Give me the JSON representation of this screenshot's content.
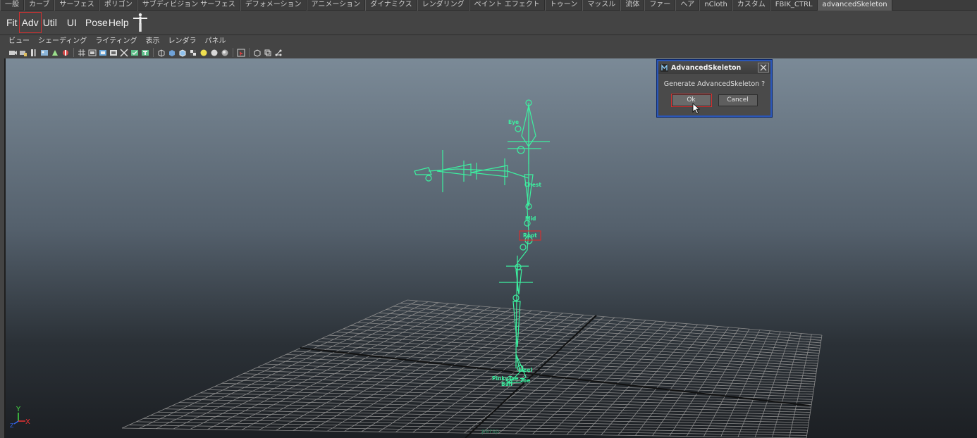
{
  "shelf_tabs": [
    {
      "label": "一般"
    },
    {
      "label": "カーブ"
    },
    {
      "label": "サーフェス"
    },
    {
      "label": "ポリゴン"
    },
    {
      "label": "サブディビジョン サーフェス"
    },
    {
      "label": "デフォメーション"
    },
    {
      "label": "アニメーション"
    },
    {
      "label": "ダイナミクス"
    },
    {
      "label": "レンダリング"
    },
    {
      "label": "ペイント エフェクト"
    },
    {
      "label": "トゥーン"
    },
    {
      "label": "マッスル"
    },
    {
      "label": "流体"
    },
    {
      "label": "ファー"
    },
    {
      "label": "ヘア"
    },
    {
      "label": "nCloth"
    },
    {
      "label": "カスタム"
    },
    {
      "label": "FBIK_CTRL"
    },
    {
      "label": "advancedSkeleton",
      "active": true
    }
  ],
  "shelf_buttons": {
    "fit": "Fit",
    "adv": "Adv",
    "util": "Util",
    "ui": "UI",
    "pose": "Pose",
    "help": "Help"
  },
  "panel_menu": {
    "view": "ビュー",
    "shading": "シェーディング",
    "lighting": "ライティング",
    "show": "表示",
    "renderer": "レンダラ",
    "panels": "パネル"
  },
  "viewport": {
    "camera_label": "persp",
    "axis": {
      "y": "Y",
      "x": "X",
      "z": "Z"
    },
    "joint_labels": {
      "eye": "Eye",
      "chest": "Chest",
      "mid": "Mid",
      "root": "Root",
      "heel": "Heel",
      "pinky_toe": "PinkyToe",
      "ball": "Ball",
      "toe": "Toe"
    }
  },
  "dialog": {
    "title": "AdvancedSkeleton",
    "message": "Generate AdvancedSkeleton ?",
    "ok_label": "Ok",
    "cancel_label": "Cancel"
  },
  "colors": {
    "skeleton": "#3cf0a0",
    "grid": "#8c8c8c",
    "grid_axis": "#111111",
    "highlight": "#d23030",
    "dialog_border": "#2a56b8"
  }
}
